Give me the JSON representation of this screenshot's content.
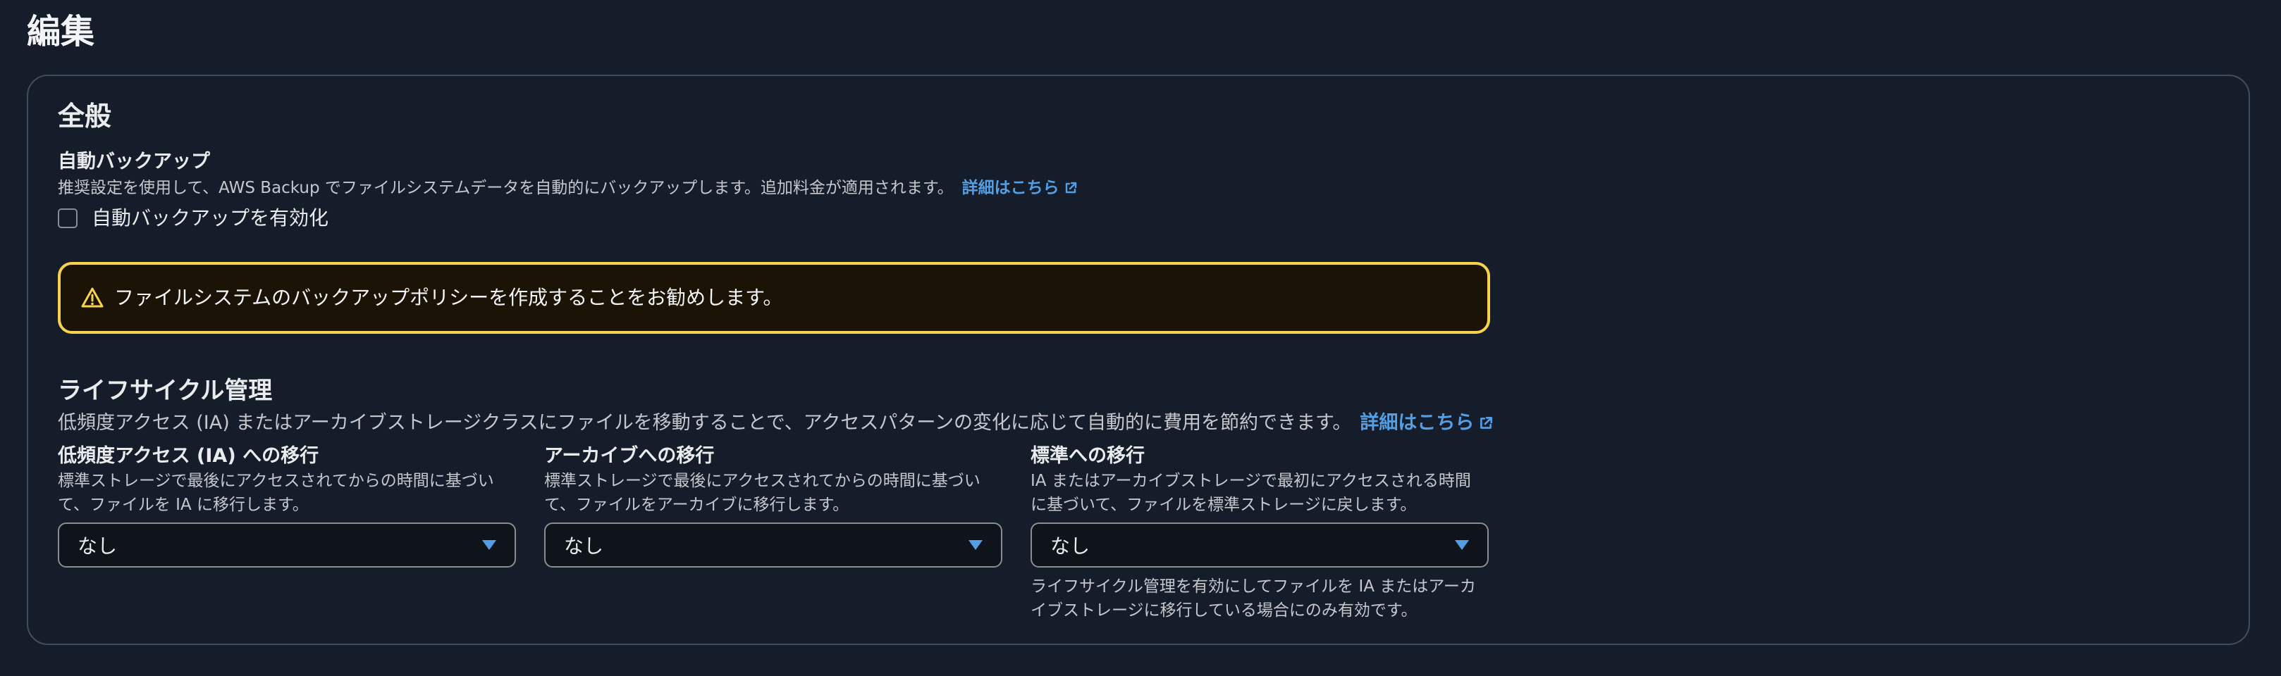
{
  "page": {
    "title": "編集"
  },
  "general": {
    "title": "全般",
    "backup": {
      "label": "自動バックアップ",
      "description": "推奨設定を使用して、AWS Backup でファイルシステムデータを自動的にバックアップします。追加料金が適用されます。",
      "link": "詳細はこちら",
      "checkbox_label": "自動バックアップを有効化",
      "checked": false
    },
    "alert": {
      "type": "warning",
      "text": "ファイルシステムのバックアップポリシーを作成することをお勧めします。"
    }
  },
  "lifecycle": {
    "title": "ライフサイクル管理",
    "description": "低頻度アクセス (IA) またはアーカイブストレージクラスにファイルを移動することで、アクセスパターンの変化に応じて自動的に費用を節約できます。",
    "link": "詳細はこちら",
    "columns": [
      {
        "label": "低頻度アクセス (IA) への移行",
        "description": "標準ストレージで最後にアクセスされてからの時間に基づいて、ファイルを IA に移行します。",
        "value": "なし"
      },
      {
        "label": "アーカイブへの移行",
        "description": "標準ストレージで最後にアクセスされてからの時間に基づいて、ファイルをアーカイブに移行します。",
        "value": "なし"
      },
      {
        "label": "標準への移行",
        "description": "IA またはアーカイブストレージで最初にアクセスされる時間に基づいて、ファイルを標準ストレージに戻します。",
        "value": "なし",
        "constraint": "ライフサイクル管理を有効にしてファイルを IA またはアーカイブストレージに移行している場合にのみ有効です。"
      }
    ]
  },
  "colors": {
    "background": "#161d2a",
    "border": "#414d5c",
    "link": "#539fe5",
    "warning_border": "#f7d34b",
    "warning_bg": "#1b1406"
  },
  "icons": {
    "external": "external-link-icon",
    "warning": "warning-icon",
    "caret": "caret-down-icon"
  }
}
